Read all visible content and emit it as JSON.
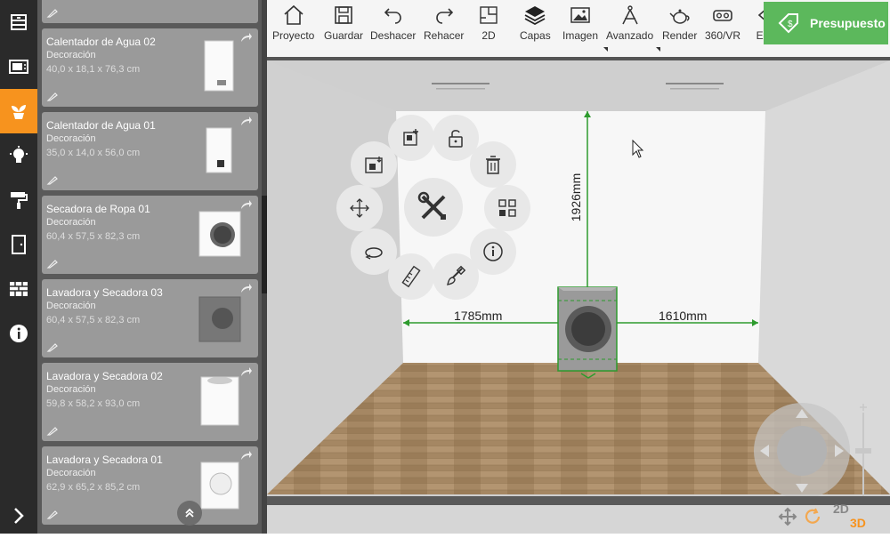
{
  "rail": {
    "items": [
      {
        "icon": "cabinet-icon"
      },
      {
        "icon": "appliance-icon"
      },
      {
        "icon": "plant-icon",
        "active": true
      },
      {
        "icon": "lightbulb-icon"
      },
      {
        "icon": "paint-roller-icon"
      },
      {
        "icon": "door-icon"
      },
      {
        "icon": "brick-wall-icon"
      },
      {
        "icon": "info-icon"
      }
    ]
  },
  "catalog": {
    "items": [
      {
        "name": "",
        "category": "",
        "dims": ""
      },
      {
        "name": "Calentador de Agua 02",
        "category": "Decoración",
        "dims": "40,0 x 18,1 x 76,3 cm"
      },
      {
        "name": "Calentador de Agua 01",
        "category": "Decoración",
        "dims": "35,0 x 14,0 x 56,0 cm"
      },
      {
        "name": "Secadora de Ropa 01",
        "category": "Decoración",
        "dims": "60,4 x 57,5 x 82,3 cm"
      },
      {
        "name": "Lavadora y Secadora 03",
        "category": "Decoración",
        "dims": "60,4 x 57,5 x 82,3 cm"
      },
      {
        "name": "Lavadora y Secadora 02",
        "category": "Decoración",
        "dims": "59,8 x 58,2 x 93,0 cm"
      },
      {
        "name": "Lavadora y Secadora 01",
        "category": "Decoración",
        "dims": "62,9 x 65,2 x 85,2 cm"
      }
    ]
  },
  "toolbar": {
    "project": "Proyecto",
    "save": "Guardar",
    "undo": "Deshacer",
    "redo": "Rehacer",
    "view2d": "2D",
    "layers": "Capas",
    "image": "Imagen",
    "advanced": "Avanzado",
    "render": "Render",
    "vr": "360/VR",
    "more": "En",
    "budget": "Presupuesto"
  },
  "viewport": {
    "dim_left": "1785mm",
    "dim_right": "1610mm",
    "dim_height": "1926mm",
    "toggle_2d": "2D",
    "toggle_3d": "3D"
  },
  "colors": {
    "accent": "#f7931e",
    "budget": "#5cb85c",
    "dimension": "#2e9b2e"
  }
}
